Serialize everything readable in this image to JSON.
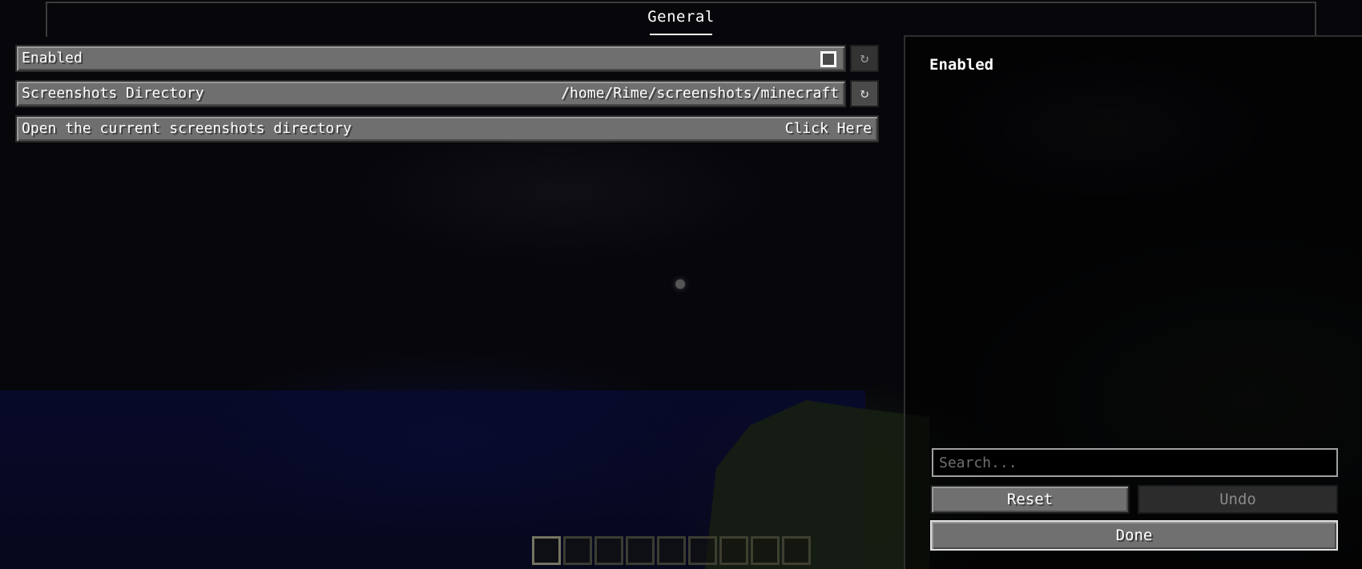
{
  "tabs": [
    {
      "label": "General",
      "selected": true
    }
  ],
  "options": [
    {
      "label": "Enabled",
      "type": "checkbox",
      "checked": false,
      "reset_icon": "↻"
    },
    {
      "label": "Screenshots Directory",
      "type": "text",
      "value": "/home/Rime/screenshots/minecraft",
      "reset_icon": "↻"
    },
    {
      "label": "Open the current screenshots directory",
      "type": "button",
      "value": "Click Here"
    }
  ],
  "side_panel": {
    "title": "Enabled",
    "search_placeholder": "Search...",
    "reset_label": "Reset",
    "undo_label": "Undo",
    "done_label": "Done"
  },
  "colors": {
    "button_face": "#707070",
    "disabled_button": "#2c2c2c",
    "text": "#ffffff"
  }
}
